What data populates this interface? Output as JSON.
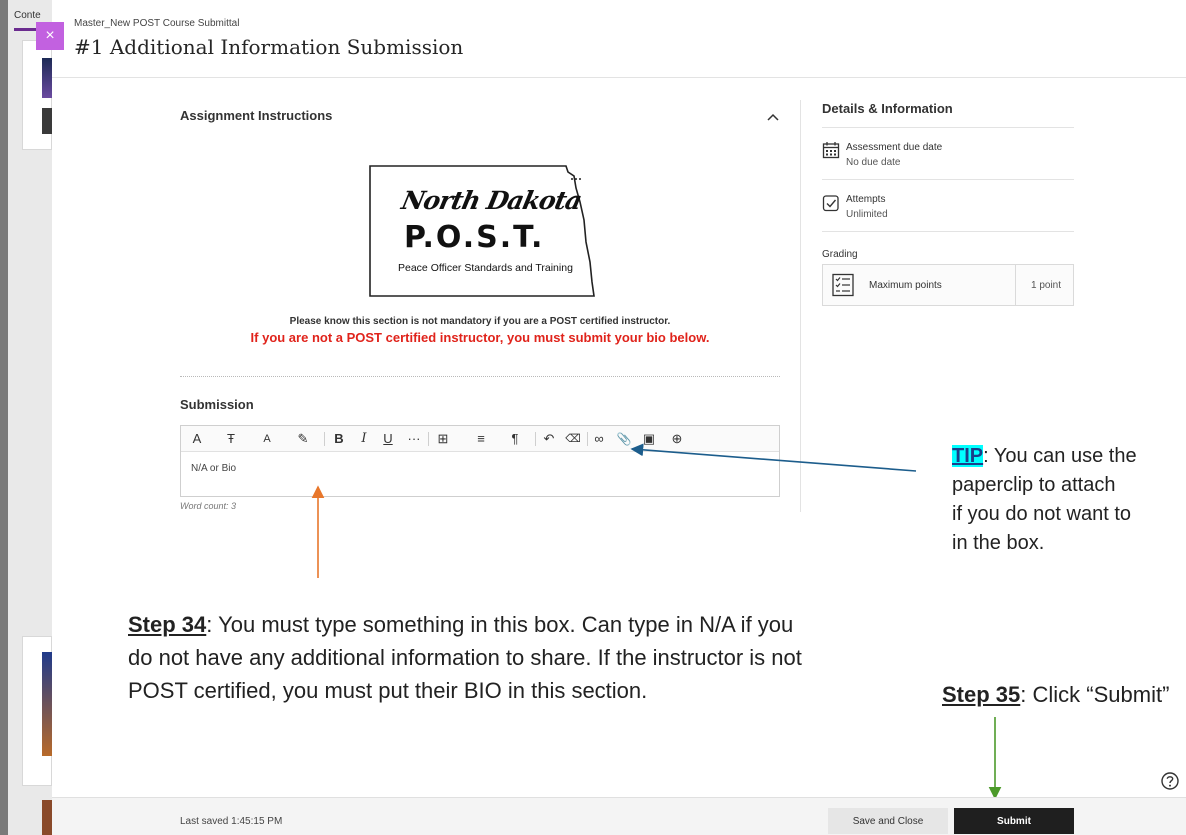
{
  "background_page": {
    "tab_label": "Conte"
  },
  "header": {
    "close_glyph": "×",
    "breadcrumb": "Master_New POST Course Submittal",
    "title": "#1 Additional Information Submission"
  },
  "instructions": {
    "heading": "Assignment Instructions",
    "logo": {
      "state_text": "North Dakota",
      "acronym": "P.O.S.T.",
      "full_name": "Peace Officer Standards and Training"
    },
    "note_primary": "Please know this section is not mandatory if you are a POST certified instructor.",
    "note_warning": "If you are not a POST certified instructor, you must submit your bio below."
  },
  "submission": {
    "heading": "Submission",
    "editor_text": "N/A or Bio",
    "word_count": "Word count: 3",
    "toolbar": {
      "text_style": "A",
      "paragraph": "Ŧ",
      "font_size": "A",
      "highlight": "✎",
      "bold": "B",
      "italic": "I",
      "underline": "U",
      "more": "···",
      "table": "⊞",
      "align": "≡",
      "format": "¶",
      "undo": "↶",
      "clear_format": "⌫",
      "link": "∞",
      "attach": "📎",
      "image": "▣",
      "insert": "⊕"
    }
  },
  "details": {
    "heading": "Details & Information",
    "due_label": "Assessment due date",
    "due_value": "No due date",
    "attempts_label": "Attempts",
    "attempts_value": "Unlimited",
    "grading_label": "Grading",
    "max_points_label": "Maximum points",
    "max_points_value": "1 point"
  },
  "annotations": {
    "tip": {
      "label": "TIP",
      "line1": ": You can use the",
      "line2": "paperclip to attach",
      "line3": "if you do not want to",
      "line4": "in the box."
    },
    "step34": {
      "label": "Step 34",
      "text": ": You must type something in this box. Can type in N/A if you do not have any additional information to share. If the instructor is not POST certified, you must put their BIO in this section."
    },
    "step35": {
      "label": "Step 35",
      "text": ": Click “Submit”"
    },
    "colors": {
      "tip_arrow": "#1c5d8c",
      "step34_arrow": "#e8772b",
      "step35_arrow": "#4c9a2a",
      "tip_highlight": "#00ffff"
    }
  },
  "footer": {
    "last_saved": "Last saved 1:45:15 PM",
    "save_close_label": "Save and Close",
    "submit_label": "Submit"
  }
}
